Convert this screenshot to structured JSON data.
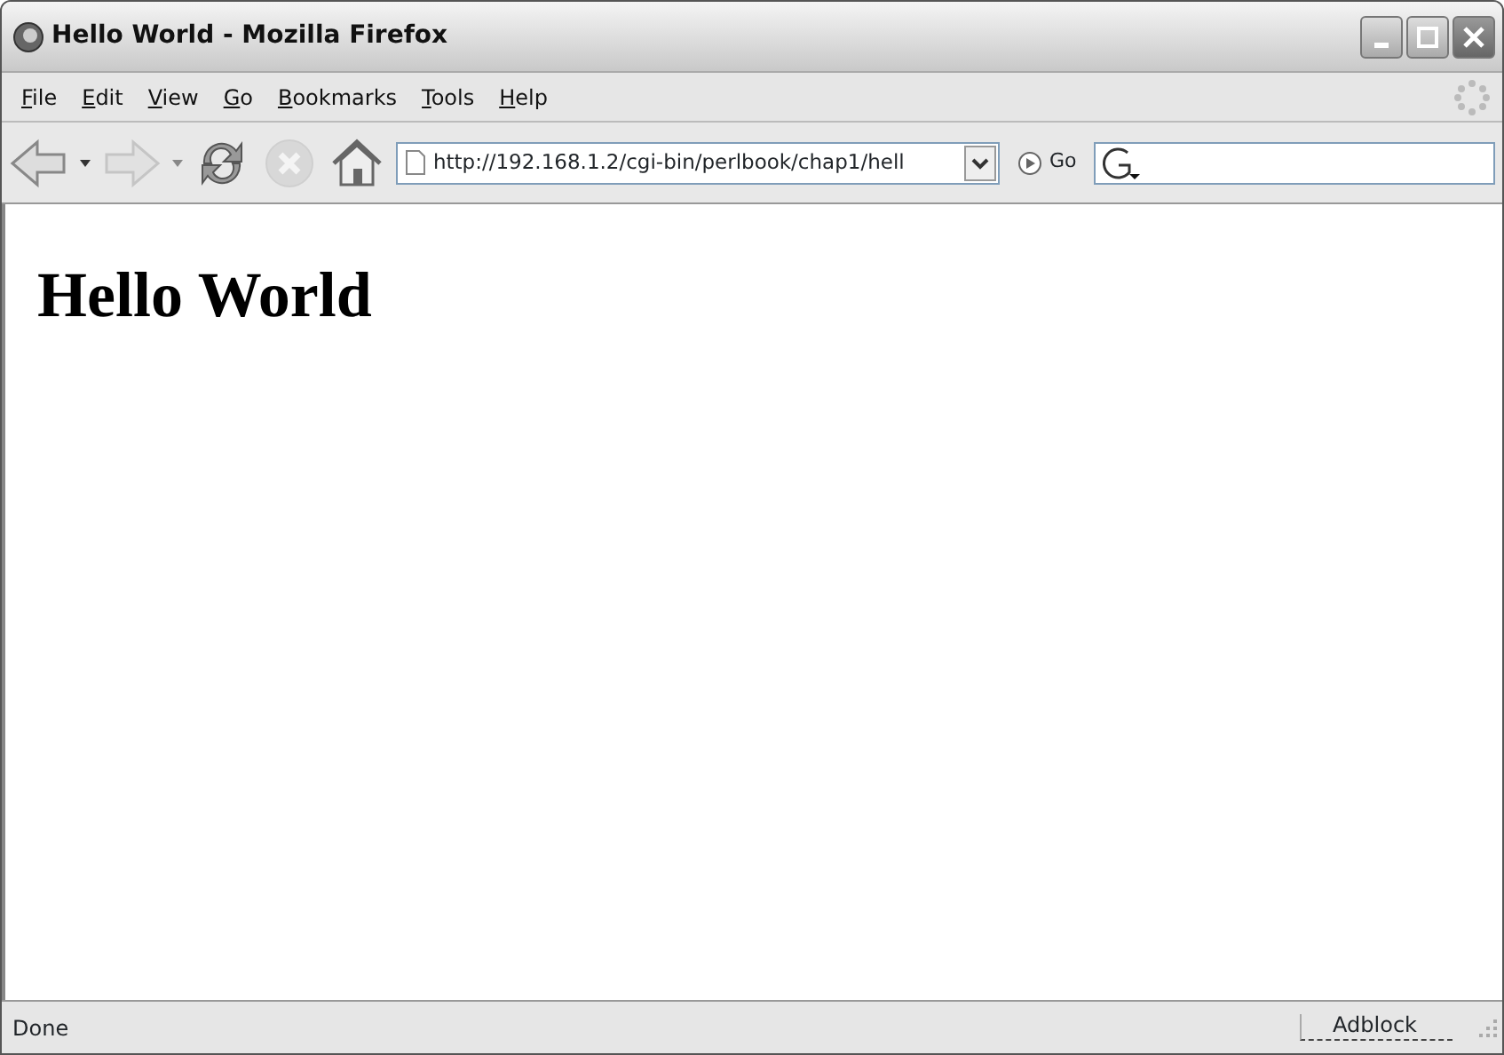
{
  "window": {
    "title": "Hello World - Mozilla Firefox"
  },
  "menu": [
    {
      "label": "File",
      "mnemonic_underlined": true
    },
    {
      "label": "Edit",
      "mnemonic_underlined": true
    },
    {
      "label": "View",
      "mnemonic_underlined": true
    },
    {
      "label": "Go",
      "mnemonic_underlined": true
    },
    {
      "label": "Bookmarks",
      "mnemonic_underlined": true
    },
    {
      "label": "Tools",
      "mnemonic_underlined": true
    },
    {
      "label": "Help",
      "mnemonic_underlined": true
    }
  ],
  "toolbar": {
    "back_disabled": false,
    "forward_disabled": true,
    "stop_disabled": true
  },
  "address": {
    "value": "http://192.168.1.2/cgi-bin/perlbook/chap1/hell",
    "go_label": "Go"
  },
  "page": {
    "heading": "Hello World"
  },
  "status_bar": {
    "text": "Done",
    "panel": "Adblock"
  }
}
